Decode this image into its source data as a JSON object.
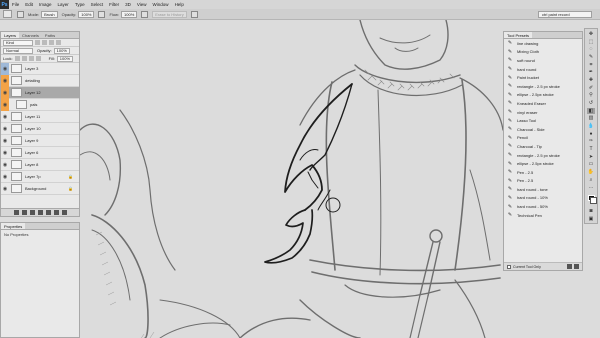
{
  "app": {
    "logo": "Ps"
  },
  "menu": [
    "File",
    "Edit",
    "Image",
    "Layer",
    "Type",
    "Select",
    "Filter",
    "3D",
    "View",
    "Window",
    "Help"
  ],
  "options": {
    "mode_label": "Mode:",
    "mode_value": "Brush",
    "opacity_label": "Opacity:",
    "opacity_value": "100%",
    "flow_label": "Flow:",
    "flow_value": "100%",
    "erase_history": "Erase to History",
    "preset_search": "ctrl paint record"
  },
  "layers": {
    "tabs": [
      "Layers",
      "Channels",
      "Paths"
    ],
    "filter_placeholder": "Kind",
    "blend_mode": "Normal",
    "opacity_label": "Opacity:",
    "opacity_value": "100%",
    "lock_label": "Lock:",
    "fill_label": "Fill:",
    "fill_value": "100%",
    "items": [
      {
        "name": "Layer 3",
        "eye": "blue",
        "indent": false,
        "selected": false,
        "lock": false
      },
      {
        "name": "detailing",
        "eye": "orange",
        "indent": false,
        "selected": false,
        "lock": false
      },
      {
        "name": "Layer 12",
        "eye": "orange",
        "indent": false,
        "selected": true,
        "lock": false
      },
      {
        "name": "pals",
        "eye": "orange",
        "indent": true,
        "selected": false,
        "lock": false
      },
      {
        "name": "Layer 11",
        "eye": "",
        "indent": false,
        "selected": false,
        "lock": false
      },
      {
        "name": "Layer 10",
        "eye": "",
        "indent": false,
        "selected": false,
        "lock": false
      },
      {
        "name": "Layer 9",
        "eye": "",
        "indent": false,
        "selected": false,
        "lock": false
      },
      {
        "name": "Layer 6",
        "eye": "",
        "indent": false,
        "selected": false,
        "lock": false
      },
      {
        "name": "Layer 8",
        "eye": "",
        "indent": false,
        "selected": false,
        "lock": false
      },
      {
        "name": "Layer 7p",
        "eye": "",
        "indent": false,
        "selected": false,
        "lock": true
      },
      {
        "name": "Background",
        "eye": "",
        "indent": false,
        "selected": false,
        "lock": true
      }
    ]
  },
  "properties": {
    "title": "Properties",
    "empty": "No Properties"
  },
  "presets": {
    "title": "Tool Presets",
    "items": [
      "line drawing",
      "Mixing Cloth",
      "soft round",
      "hard round",
      "Paint bucket",
      "rectangle - 2.5 px stroke",
      "ellipse - 2.5px stroke",
      "Kneaded Eraser",
      "vinyl eraser",
      "Lasso Tool",
      "Charcoal - Side",
      "Pencil",
      "Charcoal - Tip",
      "rectangle - 2.5 px stroke",
      "ellipse - 2.5px stroke",
      "Pen - 2.5",
      "Pen - 2.5",
      "hard round - tone",
      "hard round - 10%",
      "hard round - 50%",
      "Technical Pen"
    ],
    "current_only": "Current Tool Only"
  },
  "icons": {
    "visibility": "eye-icon",
    "lock": "lock-icon",
    "brush": "brush-icon"
  }
}
